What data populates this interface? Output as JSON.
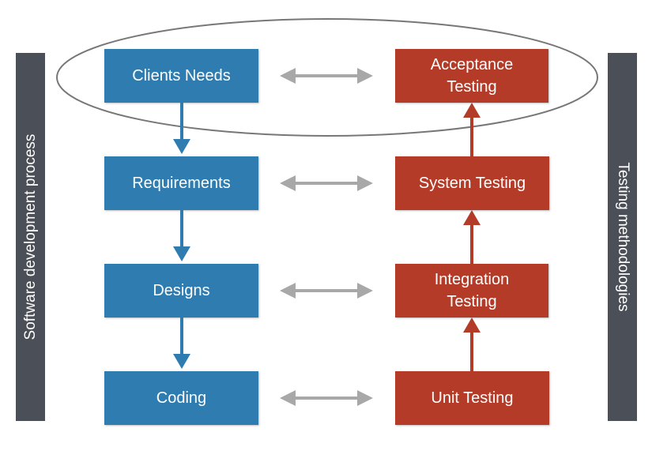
{
  "left_bar": {
    "label": "Software development process"
  },
  "right_bar": {
    "label": "Testing methodologies"
  },
  "development": [
    {
      "label": "Clients Needs"
    },
    {
      "label": "Requirements"
    },
    {
      "label": "Designs"
    },
    {
      "label": "Coding"
    }
  ],
  "testing": [
    {
      "label": "Acceptance Testing"
    },
    {
      "label": "System Testing"
    },
    {
      "label": "Integration Testing"
    },
    {
      "label": "Unit Testing"
    }
  ],
  "colors": {
    "development": "#2f7cb1",
    "testing": "#b33b27",
    "bar": "#4b4f58",
    "link_arrow": "#a8a8a8",
    "ellipse": "#777777"
  }
}
